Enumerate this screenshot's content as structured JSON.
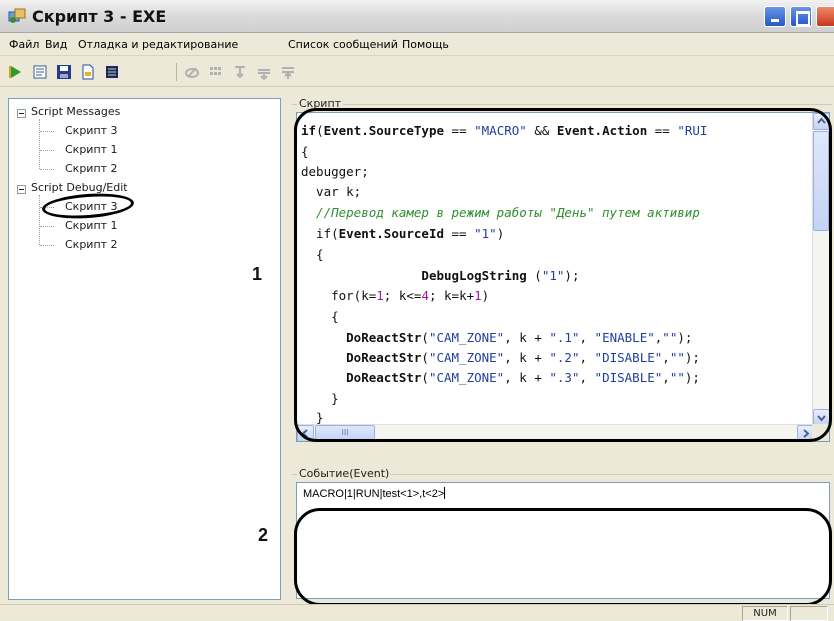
{
  "window": {
    "title": "Скрипт 3 - EXE",
    "controls": [
      "minimize",
      "maximize",
      "close"
    ]
  },
  "menu": {
    "items": [
      "Файл",
      "Вид",
      "Отладка и редактирование",
      "Список сообщений",
      "Помощь"
    ]
  },
  "toolbar": {
    "icons": [
      "run-icon",
      "step-icon",
      "save-icon",
      "new-file-icon",
      "list-icon",
      "clear-icon",
      "grid-icon",
      "step-into-icon",
      "step-over-icon",
      "step-out-icon"
    ]
  },
  "tree": {
    "groups": [
      {
        "label": "Script Messages",
        "children": [
          "Скрипт 3",
          "Скрипт 1",
          "Скрипт 2"
        ]
      },
      {
        "label": "Script Debug/Edit",
        "children": [
          "Скрипт 3",
          "Скрипт 1",
          "Скрипт 2"
        ]
      }
    ],
    "selected": "Script Debug/Edit / Скрипт 3"
  },
  "annotations": {
    "one": "1",
    "two": "2"
  },
  "script": {
    "group_label": "Скрипт",
    "lines": [
      "if(Event.SourceType == \"MACRO\" && Event.Action == \"RUI",
      "{",
      "debugger;",
      "  var k;",
      "  //Перевод камер в режим работы \"День\" путем активир",
      "  if(Event.SourceId == \"1\")",
      "  {",
      "                DebugLogString (\"1\");",
      "    for(k=1; k<=4; k=k+1)",
      "    {",
      "      DoReactStr(\"CAM_ZONE\", k + \".1\", \"ENABLE\",\"\");",
      "      DoReactStr(\"CAM_ZONE\", k + \".2\", \"DISABLE\",\"\");",
      "      DoReactStr(\"CAM_ZONE\", k + \".3\", \"DISABLE\",\"\");",
      "    }",
      "  }"
    ],
    "hscroll_thumb": "III"
  },
  "event": {
    "group_label": "Событие(Event)",
    "value": "MACRO|1|RUN|test<1>,t<2>"
  },
  "status": {
    "num": "NUM"
  },
  "colors": {
    "string": "#1f3fa0",
    "comment": "#2f8f2f",
    "number": "#9a1a9a",
    "border": "#7f9db9",
    "window_bg": "#ece9d8"
  }
}
